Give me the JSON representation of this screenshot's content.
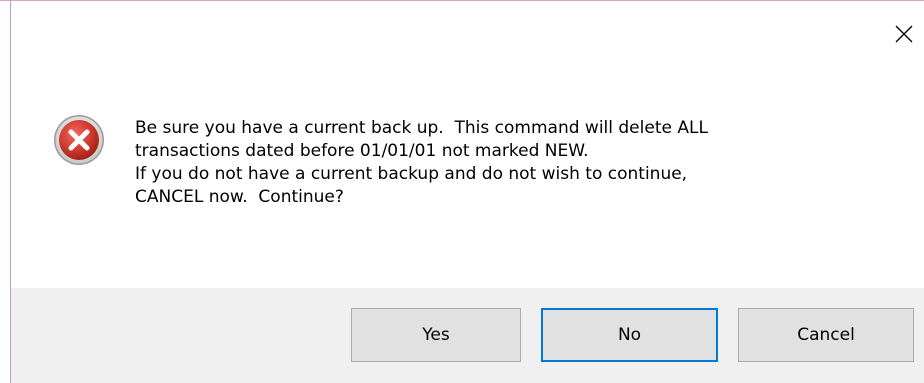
{
  "dialog": {
    "message_lines": [
      "Be sure you have a current back up.  This command will delete ALL",
      "transactions dated before 01/01/01 not marked NEW.",
      "If you do not have a current backup and do not wish to continue,",
      "CANCEL now.  Continue?"
    ],
    "icon": "error-icon",
    "close_icon": "close-icon",
    "buttons": {
      "yes": "Yes",
      "no": "No",
      "cancel": "Cancel"
    },
    "colors": {
      "error_red": "#c9302c",
      "focus_border": "#0078d7",
      "footer_bg": "#f0f0f0",
      "button_bg": "#e1e1e1"
    }
  }
}
